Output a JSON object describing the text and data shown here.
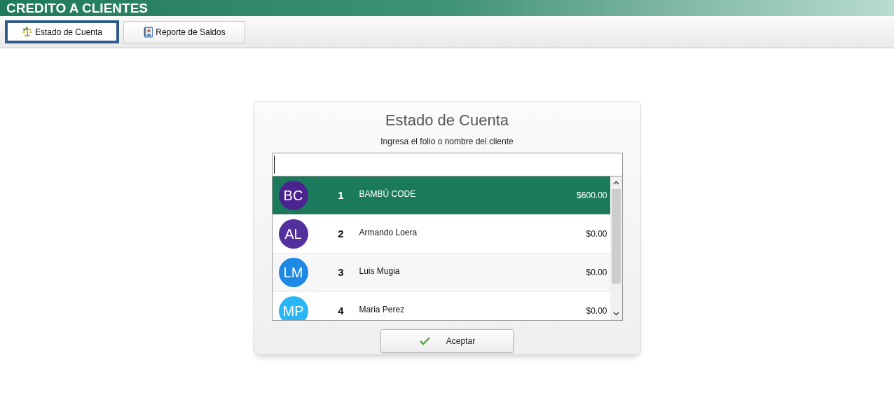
{
  "app_title": "CREDITO A CLIENTES",
  "tabs": [
    {
      "label": "Estado de Cuenta",
      "selected": true
    },
    {
      "label": "Reporte de Saldos",
      "selected": false
    }
  ],
  "dialog": {
    "title": "Estado de Cuenta",
    "prompt": "Ingresa el folio o nombre del cliente",
    "clients": [
      {
        "initials": "BC",
        "color": "#4b2391",
        "number": "1",
        "name": "BAMBÚ CODE",
        "balance": "$600.00",
        "selected": true
      },
      {
        "initials": "AL",
        "color": "#52309e",
        "number": "2",
        "name": "Armando Loera",
        "balance": "$0.00",
        "selected": false
      },
      {
        "initials": "LM",
        "color": "#1e88e5",
        "number": "3",
        "name": "Luis Mugia",
        "balance": "$0.00",
        "selected": false
      },
      {
        "initials": "MP",
        "color": "#29b6f6",
        "number": "4",
        "name": "Maria Perez",
        "balance": "$0.00",
        "selected": false
      }
    ],
    "button": "Aceptar"
  }
}
